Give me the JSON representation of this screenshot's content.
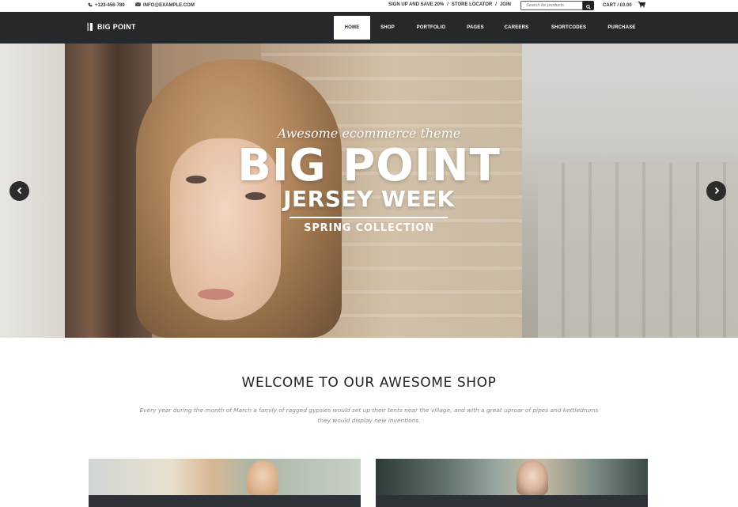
{
  "topbar": {
    "phone": "+123-456-789",
    "email": "INFO@EXAMPLE.COM",
    "links": [
      "SIGN UP AND SAVE 20%",
      "STORE LOCATOR",
      "JOIN"
    ],
    "separator": "/",
    "search_placeholder": "Search for products",
    "cart_label": "CART / £0.00"
  },
  "brand": {
    "name": "BIG POINT"
  },
  "nav": {
    "items": [
      "HOME",
      "SHOP",
      "PORTFOLIO",
      "PAGES",
      "CAREERS",
      "SHORTCODES",
      "PURCHASE"
    ],
    "active": "HOME"
  },
  "hero": {
    "tagline": "Awesome ecommerce theme",
    "headline": "BIG POINT",
    "subhead": "JERSEY WEEK",
    "collection": "SPRING COLLECTION"
  },
  "welcome": {
    "title": "WELCOME TO OUR AWESOME SHOP",
    "text": "Every year during the month of March a family of ragged gypsies would set up their tents near the village, and with a great uproar of pipes and kettledrums they would display new inventions."
  },
  "icons": {
    "phone": "phone-icon",
    "email": "envelope-icon",
    "search": "search-icon",
    "cart": "cart-icon",
    "prev": "chevron-left-icon",
    "next": "chevron-right-icon"
  },
  "colors": {
    "nav_bg": "#26292c",
    "active_bg": "#ffffff",
    "heading": "#222222",
    "body_text": "#888888"
  }
}
